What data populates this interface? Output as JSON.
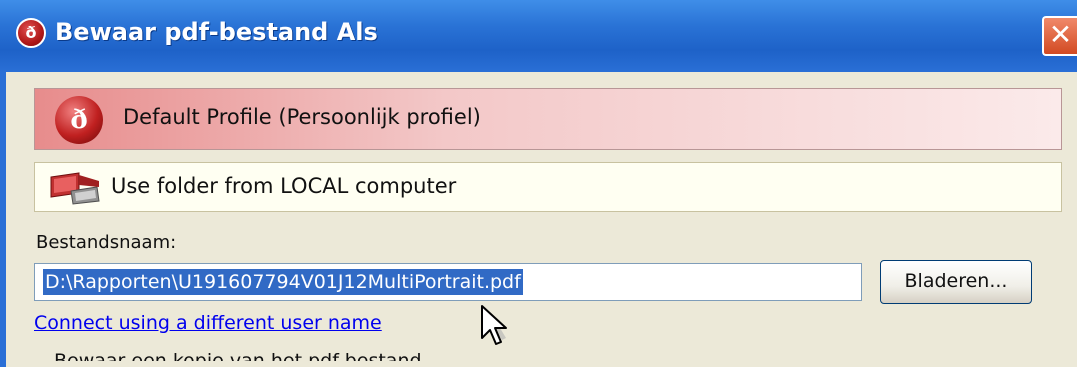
{
  "window": {
    "title": "Bewaar pdf-bestand Als",
    "close_symbol": "✕"
  },
  "profile": {
    "logo_glyph": "ð",
    "label": "Default Profile (Persoonlijk profiel)"
  },
  "location": {
    "icon": "computer-icon",
    "label": "Use folder from LOCAL computer"
  },
  "filename": {
    "label": "Bestandsnaam:",
    "value": "D:\\Rapporten\\U191607794V01J12MultiPortrait.pdf"
  },
  "browse_button": {
    "label": "Bladeren..."
  },
  "connect_link": {
    "label": "Connect using a different user name"
  },
  "partial_option": {
    "label": "Bewaar een kopie van het pdf-bestand"
  },
  "colors": {
    "titlebar": "#2a73d6",
    "profile_bar_start": "#e78c8c",
    "selection": "#316ac5",
    "link": "#0000ee",
    "dialog_bg": "#ece9d8"
  }
}
